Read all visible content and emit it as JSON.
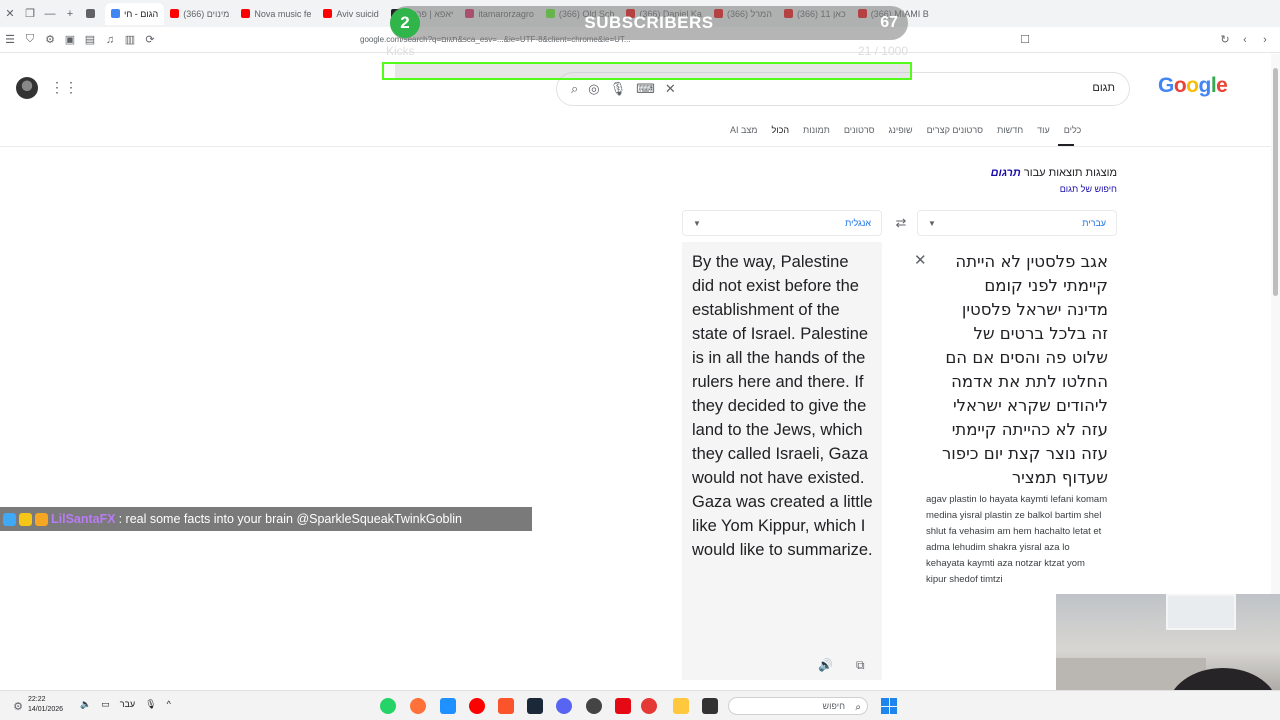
{
  "browser": {
    "tabs": [
      {
        "label": "",
        "color": "#5f6368"
      },
      {
        "label": "הגום - חי",
        "color": "#4285f4",
        "active": true
      },
      {
        "label": "(366) מינוים",
        "color": "#ff0000"
      },
      {
        "label": "Nova music fe",
        "color": "#ff0000"
      },
      {
        "label": "Aviv suicid",
        "color": "#ff0000"
      },
      {
        "label": "יאפא | פרק 7",
        "color": "#202124"
      },
      {
        "label": "itamarorzagro",
        "color": "#e91e63"
      },
      {
        "label": "(366) Old Sch",
        "color": "#53fc18"
      },
      {
        "label": "(366) Daniel Ka",
        "color": "#ff0000"
      },
      {
        "label": "(366) המרל",
        "color": "#ff0000"
      },
      {
        "label": "(366) כאן 11",
        "color": "#ff0000"
      },
      {
        "label": "(366) MIAMI B",
        "color": "#ff0000"
      }
    ],
    "url": "google.com/search?q=תגום&sca_esv=...&ie=UTF-8&client=chrome&ie=UT..."
  },
  "overlay": {
    "subscriber_count": "2",
    "subscriber_label": "SUBSCRIBERS",
    "subscriber_goal": "67",
    "kicks_label": "Kicks",
    "kicks_count": "21 / 1000",
    "kicks_progress": 0.021
  },
  "google": {
    "logo": [
      "G",
      "o",
      "o",
      "g",
      "l",
      "e"
    ],
    "query": "תגום",
    "nav_tabs": [
      "מצב AI",
      "הכול",
      "תמונות",
      "סרטונים",
      "שופינג",
      "סרטונים קצרים",
      "חדשות",
      "עוד",
      "כלים"
    ],
    "active_tab": "הכול",
    "results_for_prefix": "מוצגות תוצאות עבור ",
    "results_for_term": "תרגום",
    "search_instead": "חיפוש של תגום"
  },
  "translate": {
    "source_lang": "עברית",
    "target_lang": "אנגלית",
    "source_lines": [
      "אגב פלסטין לא הייתה",
      "קיימתי לפני קומם",
      "מדינה ישראל פלסטין",
      "זה בלכל ברטים של",
      "שלוט פה והסים אם הם",
      "החלטו לתת את אדמה",
      "ליהודים שקרא ישראלי",
      "עזה לא כהייתה קיימתי",
      "עזה נוצר קצת יום כיפור",
      "שעדוף תמציר"
    ],
    "transliteration": "agav plastin lo hayata kaymti lefani komam medina yisral plastin ze balkol bartim shel shlut fa vehasim am hem hachalto letat et adma lehudim shakra yisral aza lo kehayata kaymti aza notzar ktzat yom kipur shedof timtzi",
    "output_text": "By the way, Palestine did not exist before the establishment of the state of Israel. Palestine is in all the hands of the rulers here and there. If they decided to give the land to the Jews, which they called Israeli, Gaza would not have existed. Gaza was created a little like Yom Kippur, which I would like to summarize."
  },
  "chat": {
    "username": "LilSantaFX",
    "message": ": real some facts into your brain @SparkleSqueakTwinkGoblin"
  },
  "taskbar": {
    "time": "22:22",
    "date": "14/01/2026",
    "lang": "עבר",
    "search_placeholder": "חיפוש"
  },
  "colors": {
    "google_blue": "#4285f4",
    "google_red": "#ea4335",
    "google_yellow": "#fbbc05",
    "google_green": "#34a853",
    "kick_green": "#53fc18",
    "link_blue": "#1a0dab"
  }
}
